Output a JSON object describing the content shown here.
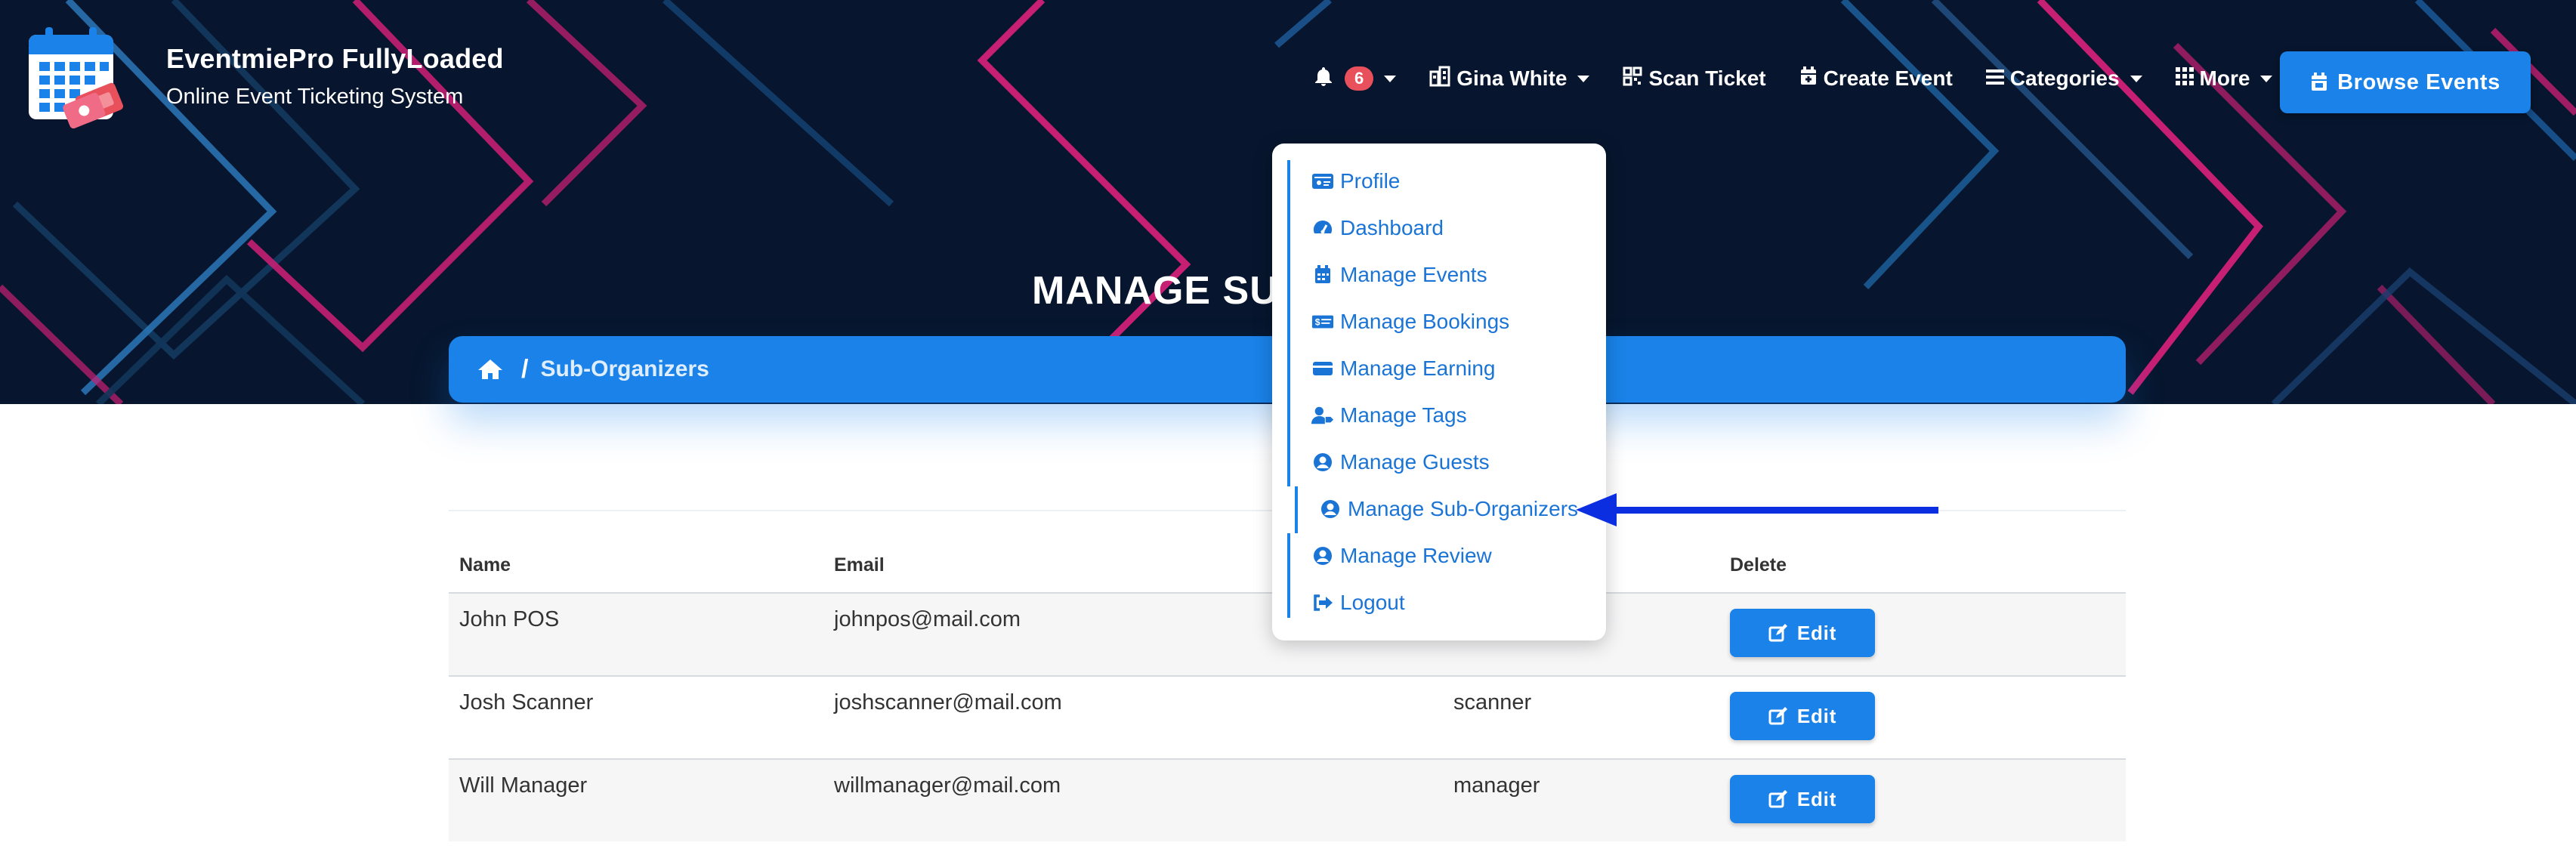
{
  "brand": {
    "title": "EventmiePro FullyLoaded",
    "subtitle": "Online Event Ticketing System",
    "logo_icon": "calendar-tickets-logo"
  },
  "nav": {
    "notifications_count": "6",
    "user_name": "Gina White",
    "scan_ticket": "Scan Ticket",
    "create_event": "Create Event",
    "categories": "Categories",
    "more": "More",
    "browse_events": "Browse Events"
  },
  "page": {
    "title": "MANAGE SUB",
    "breadcrumb_current": "Sub-Organizers",
    "breadcrumb_separator": "/"
  },
  "dropdown": {
    "items": [
      {
        "label": "Profile",
        "icon": "id-card-icon"
      },
      {
        "label": "Dashboard",
        "icon": "gauge-icon"
      },
      {
        "label": "Manage Events",
        "icon": "calendar-icon"
      },
      {
        "label": "Manage Bookings",
        "icon": "money-bill-icon"
      },
      {
        "label": "Manage Earning",
        "icon": "credit-card-icon"
      },
      {
        "label": "Manage Tags",
        "icon": "user-tag-icon"
      },
      {
        "label": "Manage Guests",
        "icon": "user-circle-icon"
      },
      {
        "label": "Manage Sub-Organizers",
        "icon": "user-circle-icon"
      },
      {
        "label": "Manage Review",
        "icon": "user-circle-icon"
      },
      {
        "label": "Logout",
        "icon": "sign-out-icon"
      }
    ]
  },
  "table": {
    "headers": [
      "Name",
      "Email",
      "Delete"
    ],
    "rows": [
      {
        "name": "John POS",
        "email": "johnpos@mail.com",
        "role": "",
        "action": "Edit"
      },
      {
        "name": "Josh Scanner",
        "email": "joshscanner@mail.com",
        "role": "scanner",
        "action": "Edit"
      },
      {
        "name": "Will Manager",
        "email": "willmanager@mail.com",
        "role": "manager",
        "action": "Edit"
      }
    ]
  },
  "colors": {
    "hero_bg": "#07162e",
    "accent_blue": "#1a82e8",
    "link_blue": "#1a74d6",
    "badge_red": "#e8505b",
    "pink_line": "#e0257a",
    "annotation_arrow": "#0b2fe0"
  }
}
